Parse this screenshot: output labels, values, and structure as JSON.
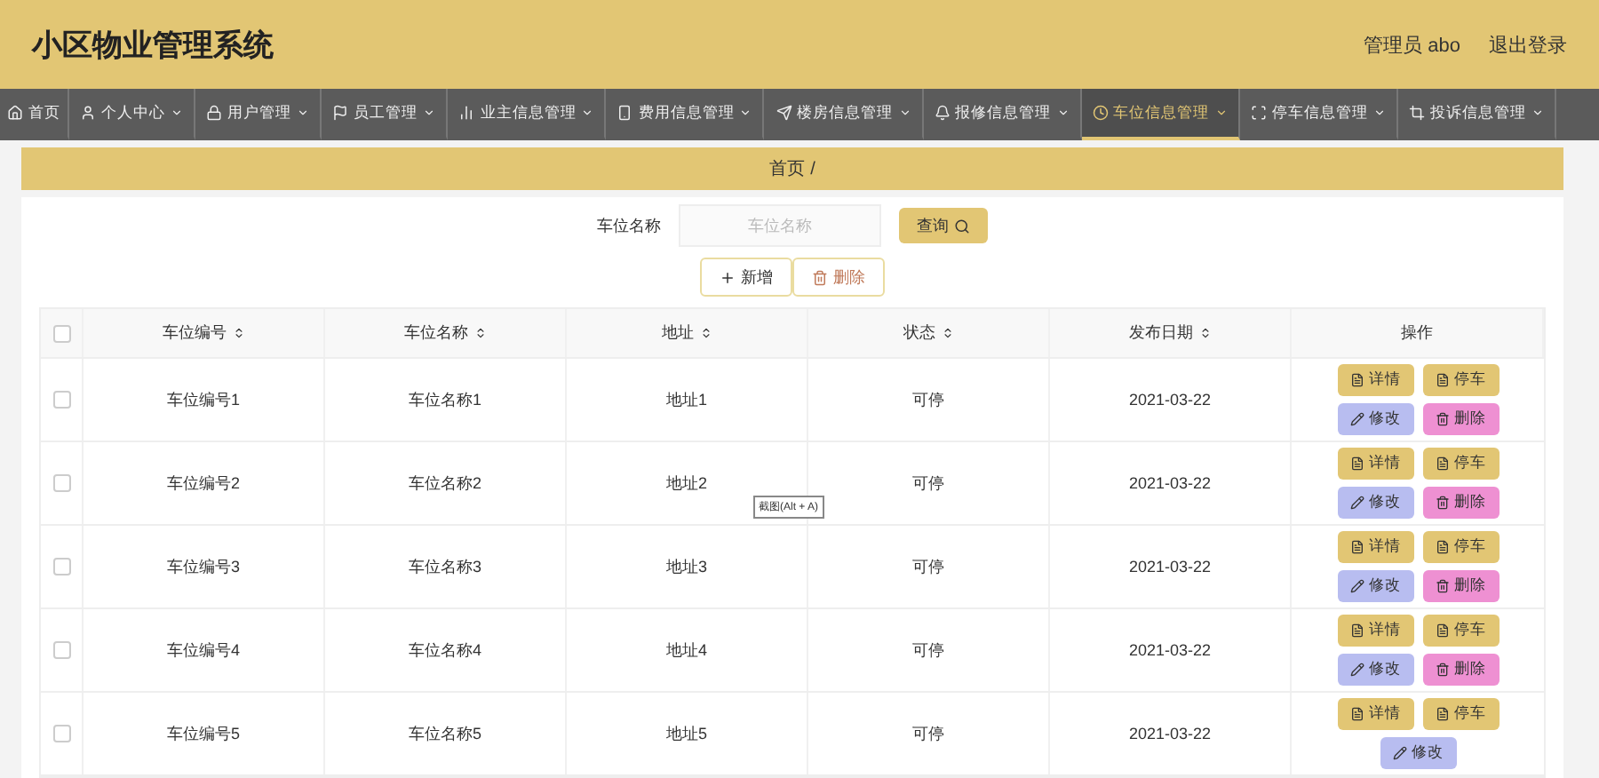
{
  "header": {
    "title": "小区物业管理系统",
    "user": "管理员 abo",
    "logout": "退出登录"
  },
  "nav": [
    {
      "label": "首页",
      "dropdown": false,
      "selected": false
    },
    {
      "label": "个人中心",
      "dropdown": true,
      "selected": false
    },
    {
      "label": "用户管理",
      "dropdown": true,
      "selected": false
    },
    {
      "label": "员工管理",
      "dropdown": true,
      "selected": false
    },
    {
      "label": "业主信息管理",
      "dropdown": true,
      "selected": false
    },
    {
      "label": "费用信息管理",
      "dropdown": true,
      "selected": false
    },
    {
      "label": "楼房信息管理",
      "dropdown": true,
      "selected": false
    },
    {
      "label": "报修信息管理",
      "dropdown": true,
      "selected": false
    },
    {
      "label": "车位信息管理",
      "dropdown": true,
      "selected": true
    },
    {
      "label": "停车信息管理",
      "dropdown": true,
      "selected": false
    },
    {
      "label": "投诉信息管理",
      "dropdown": true,
      "selected": false
    }
  ],
  "breadcrumb": [
    "首页",
    "/"
  ],
  "search": {
    "label": "车位名称",
    "placeholder": "车位名称",
    "button": "查询"
  },
  "toolbar": {
    "add": "新增",
    "delete": "删除"
  },
  "table": {
    "select_all": {
      "checked": false
    },
    "columns": [
      {
        "label": "车位编号",
        "sortable": true
      },
      {
        "label": "车位名称",
        "sortable": true
      },
      {
        "label": "地址",
        "sortable": true
      },
      {
        "label": "状态",
        "sortable": true
      },
      {
        "label": "发布日期",
        "sortable": true
      },
      {
        "label": "操作",
        "sortable": false
      }
    ],
    "rows": [
      {
        "checked": false,
        "cells": [
          "车位编号1",
          "车位名称1",
          "地址1",
          "可停",
          "2021-03-22"
        ],
        "actions": [
          {
            "label": "详情",
            "kind": "detail"
          },
          {
            "label": "停车",
            "kind": "park"
          },
          {
            "label": "修改",
            "kind": "edit"
          },
          {
            "label": "删除",
            "kind": "delete"
          }
        ]
      },
      {
        "checked": false,
        "cells": [
          "车位编号2",
          "车位名称2",
          "地址2",
          "可停",
          "2021-03-22"
        ],
        "actions": [
          {
            "label": "详情",
            "kind": "detail"
          },
          {
            "label": "停车",
            "kind": "park"
          },
          {
            "label": "修改",
            "kind": "edit"
          },
          {
            "label": "删除",
            "kind": "delete"
          }
        ]
      },
      {
        "checked": false,
        "cells": [
          "车位编号3",
          "车位名称3",
          "地址3",
          "可停",
          "2021-03-22"
        ],
        "actions": [
          {
            "label": "详情",
            "kind": "detail"
          },
          {
            "label": "停车",
            "kind": "park"
          },
          {
            "label": "修改",
            "kind": "edit"
          },
          {
            "label": "删除",
            "kind": "delete"
          }
        ]
      },
      {
        "checked": false,
        "cells": [
          "车位编号4",
          "车位名称4",
          "地址4",
          "可停",
          "2021-03-22"
        ],
        "actions": [
          {
            "label": "详情",
            "kind": "detail"
          },
          {
            "label": "停车",
            "kind": "park"
          },
          {
            "label": "修改",
            "kind": "edit"
          },
          {
            "label": "删除",
            "kind": "delete"
          }
        ]
      },
      {
        "checked": false,
        "cells": [
          "车位编号5",
          "车位名称5",
          "地址5",
          "可停",
          "2021-03-22"
        ],
        "actions": [
          {
            "label": "详情",
            "kind": "detail"
          },
          {
            "label": "停车",
            "kind": "park"
          },
          {
            "label": "修改",
            "kind": "edit"
          }
        ]
      }
    ]
  },
  "tooltip": "截图(Alt + A)"
}
